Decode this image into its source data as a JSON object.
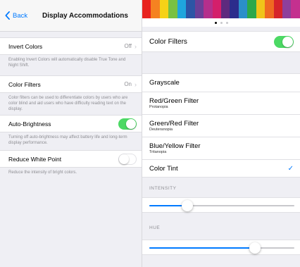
{
  "left": {
    "nav": {
      "back_label": "Back",
      "title": "Display Accommodations"
    },
    "invert_colors": {
      "label": "Invert Colors",
      "value": "Off",
      "footer": "Enabling Invert Colors will automatically disable True Tone and Night Shift."
    },
    "color_filters": {
      "label": "Color Filters",
      "value": "On",
      "footer": "Color filters can be used to differentiate colors by users who are color blind and aid users who have difficulty reading text on the display."
    },
    "auto_brightness": {
      "label": "Auto-Brightness",
      "on": true,
      "footer": "Turning off auto-brightness may affect battery life and long-term display performance."
    },
    "reduce_white_point": {
      "label": "Reduce White Point",
      "on": false,
      "footer": "Reduce the intensity of bright colors."
    }
  },
  "right": {
    "spectrum_colors": [
      "#e8231f",
      "#f58221",
      "#f6d217",
      "#79c142",
      "#1fa6dd",
      "#2d55a5",
      "#6b3f98",
      "#b52f8c",
      "#d41f6b",
      "#5e2a7e",
      "#2c2c8c",
      "#2b8fc9",
      "#2ca84a",
      "#f0c419",
      "#ef6a21",
      "#d6232a",
      "#8e3f9b",
      "#c4308f"
    ],
    "page_dots": [
      {
        "active": true,
        "color": "#000000"
      },
      {
        "active": false,
        "color": "#c7c7cc"
      },
      {
        "active": false,
        "color": "#c7c7cc"
      }
    ],
    "color_filters_label": "Color Filters",
    "color_filters_on": true,
    "options": [
      {
        "title": "Grayscale",
        "subtitle": ""
      },
      {
        "title": "Red/Green Filter",
        "subtitle": "Protanopia"
      },
      {
        "title": "Green/Red Filter",
        "subtitle": "Deuteranopia"
      },
      {
        "title": "Blue/Yellow Filter",
        "subtitle": "Tritanopia"
      },
      {
        "title": "Color Tint",
        "subtitle": "",
        "selected": true
      }
    ],
    "intensity": {
      "label": "INTENSITY",
      "value": 0.26
    },
    "hue": {
      "label": "HUE",
      "value": 0.73
    }
  },
  "colors": {
    "accent": "#007aff",
    "toggle_on": "#4cd964"
  }
}
